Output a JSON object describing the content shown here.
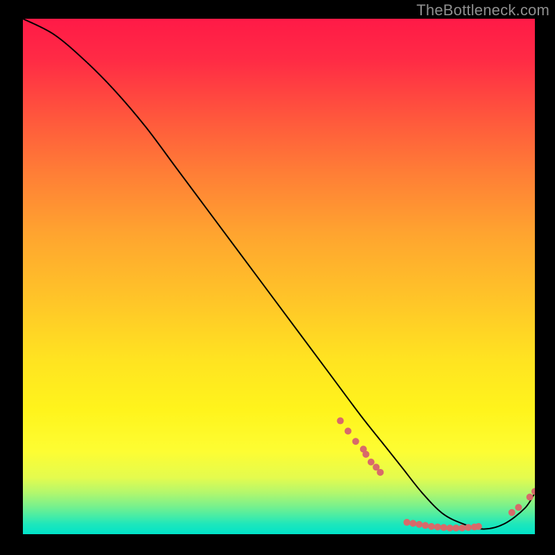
{
  "watermark": "TheBottleneck.com",
  "chart_data": {
    "type": "line",
    "title": "",
    "xlabel": "",
    "ylabel": "",
    "xlim": [
      0,
      100
    ],
    "ylim": [
      0,
      100
    ],
    "grid": false,
    "legend": false,
    "curve": {
      "x": [
        0,
        6,
        12,
        18,
        24,
        30,
        36,
        42,
        48,
        54,
        60,
        66,
        70,
        74,
        78,
        82,
        86,
        90,
        94,
        98,
        100
      ],
      "y": [
        100,
        97,
        92,
        86,
        79,
        71,
        63,
        55,
        47,
        39,
        31,
        23,
        18,
        13,
        8,
        4,
        2,
        1,
        2,
        5,
        8
      ]
    },
    "dots": {
      "color": "#d86a6a",
      "radius": 5,
      "points": [
        {
          "x": 62,
          "y": 22
        },
        {
          "x": 63.5,
          "y": 20
        },
        {
          "x": 65,
          "y": 18
        },
        {
          "x": 66.5,
          "y": 16.5
        },
        {
          "x": 67,
          "y": 15.5
        },
        {
          "x": 68,
          "y": 14
        },
        {
          "x": 69,
          "y": 13
        },
        {
          "x": 69.8,
          "y": 12
        },
        {
          "x": 75,
          "y": 2.3
        },
        {
          "x": 76.2,
          "y": 2.1
        },
        {
          "x": 77.4,
          "y": 1.9
        },
        {
          "x": 78.6,
          "y": 1.7
        },
        {
          "x": 79.8,
          "y": 1.5
        },
        {
          "x": 81,
          "y": 1.4
        },
        {
          "x": 82.2,
          "y": 1.3
        },
        {
          "x": 83.4,
          "y": 1.2
        },
        {
          "x": 84.6,
          "y": 1.2
        },
        {
          "x": 85.8,
          "y": 1.2
        },
        {
          "x": 87,
          "y": 1.3
        },
        {
          "x": 88.2,
          "y": 1.4
        },
        {
          "x": 89,
          "y": 1.5
        },
        {
          "x": 95.5,
          "y": 4.2
        },
        {
          "x": 96.8,
          "y": 5.2
        },
        {
          "x": 99.0,
          "y": 7.2
        },
        {
          "x": 100,
          "y": 8.3
        }
      ]
    }
  }
}
